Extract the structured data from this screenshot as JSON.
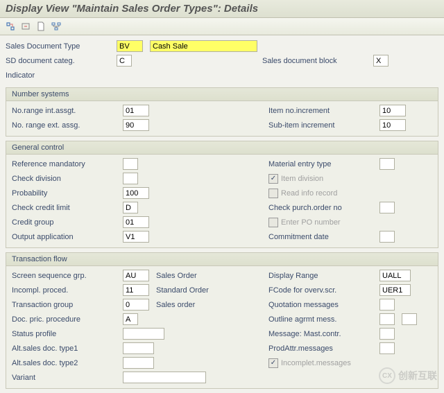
{
  "title": "Display View \"Maintain Sales Order Types\": Details",
  "header": {
    "sales_doc_type_lbl": "Sales Document Type",
    "sales_doc_type_val": "BV",
    "sales_doc_type_desc": "Cash Sale",
    "sd_cat_lbl": "SD document categ.",
    "sd_cat_val": "C",
    "sales_block_lbl": "Sales document block",
    "sales_block_val": "X",
    "indicator_lbl": "Indicator"
  },
  "number_systems": {
    "title": "Number systems",
    "int_lbl": "No.range int.assgt.",
    "int_val": "01",
    "ext_lbl": "No. range ext. assg.",
    "ext_val": "90",
    "item_inc_lbl": "Item no.increment",
    "item_inc_val": "10",
    "sub_inc_lbl": "Sub-item increment",
    "sub_inc_val": "10"
  },
  "general": {
    "title": "General control",
    "ref_lbl": "Reference mandatory",
    "chkdiv_lbl": "Check division",
    "prob_lbl": "Probability",
    "prob_val": "100",
    "credit_lbl": "Check credit limit",
    "credit_val": "D",
    "cgroup_lbl": "Credit group",
    "cgroup_val": "01",
    "output_lbl": "Output application",
    "output_val": "V1",
    "mat_lbl": "Material entry type",
    "itemdiv_lbl": "Item division",
    "readinfo_lbl": "Read info record",
    "chkpo_lbl": "Check purch.order no",
    "enterpo_lbl": "Enter PO number",
    "commit_lbl": "Commitment  date"
  },
  "trans": {
    "title": "Transaction flow",
    "seq_lbl": "Screen sequence grp.",
    "seq_val": "AU",
    "seq_desc": "Sales Order",
    "incompl_lbl": "Incompl. proced.",
    "incompl_val": "11",
    "incompl_desc": "Standard Order",
    "tgroup_lbl": "Transaction group",
    "tgroup_val": "0",
    "tgroup_desc": "Sales order",
    "docpric_lbl": "Doc. pric. procedure",
    "docpric_val": "A",
    "status_lbl": "Status profile",
    "alt1_lbl": "Alt.sales doc. type1",
    "alt2_lbl": "Alt.sales doc. type2",
    "variant_lbl": "Variant",
    "disp_lbl": "Display Range",
    "disp_val": "UALL",
    "fcode_lbl": "FCode for overv.scr.",
    "fcode_val": "UER1",
    "quot_lbl": "Quotation messages",
    "outline_lbl": "Outline agrmt mess.",
    "msgmast_lbl": "Message: Mast.contr.",
    "prodattr_lbl": "ProdAttr.messages",
    "incomplmsg_lbl": "Incomplet.messages"
  },
  "watermark": "创新互联"
}
